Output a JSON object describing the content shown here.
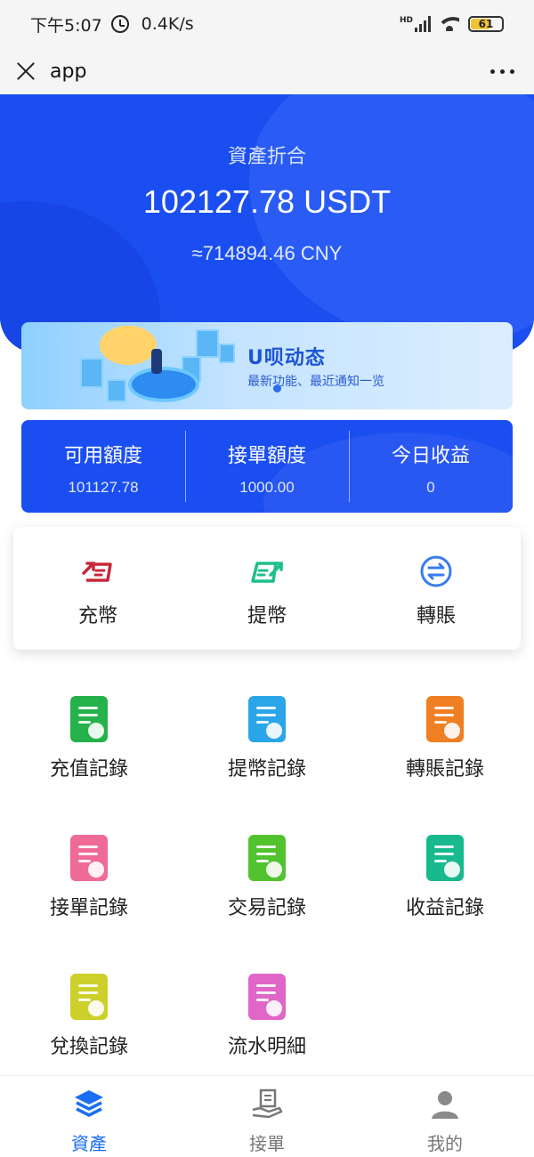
{
  "status_bar": {
    "time": "下午5:07",
    "network_speed": "0.4K/s",
    "signal_tag": "HD",
    "battery": "61"
  },
  "title_bar": {
    "title": "app"
  },
  "hero": {
    "label": "資產折合",
    "total": "102127.78 USDT",
    "cny": "≈714894.46 CNY"
  },
  "banner": {
    "title": "U呗动态",
    "subtitle": "最新功能、最近通知一览"
  },
  "stats": [
    {
      "label": "可用額度",
      "value": "101127.78"
    },
    {
      "label": "接單額度",
      "value": "1000.00"
    },
    {
      "label": "今日收益",
      "value": "0"
    }
  ],
  "quick_actions": [
    {
      "label": "充幣",
      "icon": "deposit-icon",
      "color": "#c8283a"
    },
    {
      "label": "提幣",
      "icon": "withdraw-icon",
      "color": "#1fbf8a"
    },
    {
      "label": "轉賬",
      "icon": "transfer-icon",
      "color": "#3a7bf0"
    }
  ],
  "grid": [
    {
      "label": "充值記錄",
      "icon": "deposit-record-icon",
      "color": "#25b24a"
    },
    {
      "label": "提幣記錄",
      "icon": "withdraw-record-icon",
      "color": "#2aa6e8"
    },
    {
      "label": "轉賬記錄",
      "icon": "transfer-record-icon",
      "color": "#f07e22"
    },
    {
      "label": "接單記錄",
      "icon": "order-record-icon",
      "color": "#f06a98"
    },
    {
      "label": "交易記錄",
      "icon": "trade-record-icon",
      "color": "#52c22f"
    },
    {
      "label": "收益記錄",
      "icon": "income-record-icon",
      "color": "#18b98e"
    },
    {
      "label": "兌換記錄",
      "icon": "exchange-record-icon",
      "color": "#cdd02a"
    },
    {
      "label": "流水明細",
      "icon": "flow-detail-icon",
      "color": "#e066c8"
    }
  ],
  "bottom_nav": [
    {
      "label": "資產",
      "icon": "layers-icon",
      "active": true
    },
    {
      "label": "接單",
      "icon": "hand-document-icon",
      "active": false
    },
    {
      "label": "我的",
      "icon": "user-icon",
      "active": false
    }
  ],
  "colors": {
    "primary_blue": "#1b4ef0",
    "nav_active": "#1b6ef3"
  }
}
